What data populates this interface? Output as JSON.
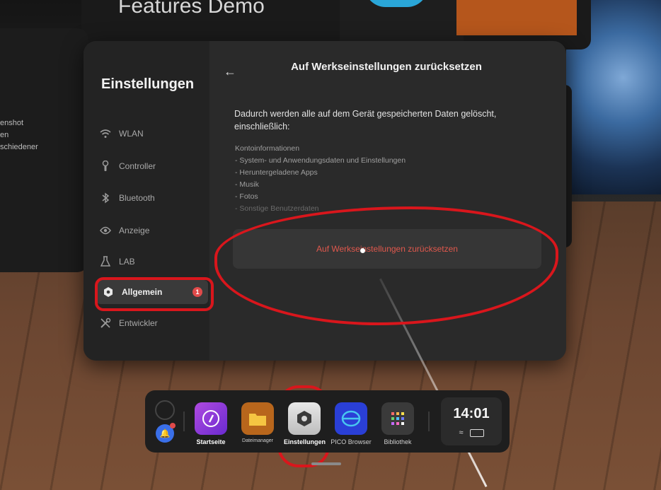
{
  "background": {
    "panel_title": "Features Demo",
    "left_panel_lines": [
      "enshot",
      "en",
      "schiedener"
    ]
  },
  "settings": {
    "heading": "Einstellungen",
    "nav": [
      {
        "label": "WLAN",
        "icon": "wifi-icon"
      },
      {
        "label": "Controller",
        "icon": "controller-icon"
      },
      {
        "label": "Bluetooth",
        "icon": "bluetooth-icon"
      },
      {
        "label": "Anzeige",
        "icon": "eye-icon"
      },
      {
        "label": "LAB",
        "icon": "flask-icon"
      },
      {
        "label": "Allgemein",
        "icon": "hexagon-settings-icon",
        "active": true,
        "badge": "1"
      },
      {
        "label": "Entwickler",
        "icon": "tools-icon"
      }
    ],
    "page": {
      "back_icon": "arrow-left-icon",
      "title": "Auf Werkseinstellungen zurücksetzen",
      "description": "Dadurch werden alle auf dem Gerät gespeicherten Daten gelöscht, einschließlich:",
      "items": [
        "Kontoinformationen",
        "- System- und Anwendungsdaten und Einstellungen",
        "- Heruntergeladene Apps",
        "- Musik",
        "- Fotos",
        "- Sonstige Benutzerdaten"
      ],
      "reset_button": "Auf Werkseinstellungen zurücksetzen",
      "reset_color": "#e0584d"
    }
  },
  "dock": {
    "apps": [
      {
        "label": "Startseite",
        "icon": "compass-icon",
        "color": "#8b3fd6"
      },
      {
        "label": "Dateimanager",
        "icon": "folder-icon",
        "color": "#c8761c"
      },
      {
        "label": "Einstellungen",
        "icon": "hexagon-settings-icon",
        "color": "#d8d8d8"
      },
      {
        "label": "PICO Browser",
        "icon": "browser-icon",
        "color": "#2a44d8"
      },
      {
        "label": "Bibliothek",
        "icon": "grid-icon",
        "color": "#3a3a3a"
      }
    ],
    "time": "14:01"
  },
  "annotation_color": "#d9161c"
}
